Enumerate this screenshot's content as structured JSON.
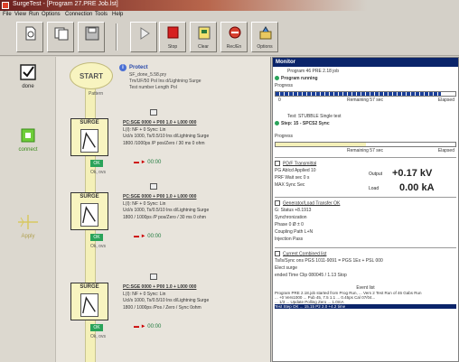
{
  "window": {
    "title": "SurgeTest - [Program 27.PRE Job.lst]"
  },
  "menu": [
    "File",
    "View",
    "Run",
    "Options",
    "Connection",
    "Tools",
    "Help"
  ],
  "toolbar": {
    "buttons": [
      {
        "name": "new-button",
        "label": "",
        "icon": "document-icon"
      },
      {
        "name": "copy-button",
        "label": "",
        "icon": "copy-icon"
      },
      {
        "name": "save-button",
        "label": "",
        "icon": "disk-icon"
      },
      {
        "name": "run-button",
        "label": "",
        "icon": "play-icon"
      },
      {
        "name": "stop-button",
        "label": "Stop",
        "icon": "stop-icon"
      },
      {
        "name": "clear-button",
        "label": "Clear",
        "icon": "clear-icon"
      },
      {
        "name": "record-button",
        "label": "Rec/En",
        "icon": "record-icon"
      },
      {
        "name": "options-button",
        "label": "Options",
        "icon": "tools-icon"
      }
    ]
  },
  "rail": {
    "items": [
      {
        "label": "done",
        "icon": "checkbox-icon"
      },
      {
        "label": "connect",
        "icon": "connect-icon"
      },
      {
        "label": "Apply",
        "icon": "crosshair-icon"
      }
    ]
  },
  "flow": {
    "start": {
      "label": "START",
      "sub": "Pattern",
      "title": "Protect",
      "lines": [
        "SF_done_5.58.pry",
        "Tm/UF/50 Pol Ins d/Lightning Surge",
        "Test number Length Pol"
      ]
    },
    "steps": [
      {
        "label": "SURGE",
        "badge": "OK",
        "check": "Ok, ovs",
        "lines": [
          "PC:SGE 0000 + P00 1.0 + L000 000",
          "L(I): NF + 0  Sync: Lin",
          "Ucl/s 1000, Ts/0.5/10 Ins d/Lightning Surge",
          "1800 /1000ps /P pos/Zero / 30 ms 0 ohm"
        ],
        "arrow": "00:00"
      },
      {
        "label": "SURGE",
        "badge": "OK",
        "check": "Ok, ovs",
        "lines": [
          "PC:SGE 0000 + P00 1.0 + L000 000",
          "L(I): NF + 0  Sync: Lin",
          "Ucl/s 1000, Ts/0.5/10 Ins d/Lightning Surge",
          "1800 / 1000ps /P pos/Zero / 30 ms 0 ohm"
        ],
        "arrow": "00:00"
      },
      {
        "label": "SURGE",
        "badge": "OK",
        "check": "Ok, ovs",
        "lines": [
          "PC:SGE 0000 + P00 1.0 + L000 000",
          "L(I): NF + 0  Sync: Lin",
          "Ucl/s 1000, Ts/0.5/10 Ins d/Lightning Surge",
          "1800 / 1000ps /Pos / Zero / Sync 0ohm"
        ],
        "arrow": "00:00"
      }
    ]
  },
  "panel": {
    "title": "Monitor",
    "group1": {
      "line1": "Program 46 PRE 2.18 job",
      "line2": "Program running",
      "progress_label": "Progress",
      "progress_value": 0.92,
      "left": "0",
      "mid": "Remaining 57 sec",
      "right": "Elapsed"
    },
    "group2": {
      "line1": "Test: STUBBLE Single test",
      "line2": "Step: 15 - SPCS2 Sync",
      "progress_label": "Progress",
      "progress_value": 0.5,
      "mid": "Remaining 57 sec",
      "right": "Elapsed"
    },
    "measure": {
      "title": "PD/F Transmittal",
      "rows": [
        "PG Ablcd Applied  10",
        "PRF Wait sec  0 s",
        "MAX Sync Sec"
      ],
      "u_label": "Output",
      "u_value": "+0.17 kV",
      "i_label": "Load",
      "i_value": "0.00 kA"
    },
    "status": {
      "title": "Generator/Load Transfer  OK",
      "rows": [
        "G: Status   +8.1913",
        "Synchronization",
        "Phase   0 Ø ± 0",
        "Coupling Path   L+N",
        "Injection   Pass"
      ]
    },
    "counters": {
      "title": "Current Combined list",
      "rows": [
        "Ts/ls/Sync ons   PGS 1011-9091 = PGS 1Ex + PSL 000",
        "Elect surge",
        "ended Time   Clip 080045 / 1.13 Stop"
      ]
    },
    "log": {
      "title": "Event list",
      "rows": [
        "Program PRE 2.18.job started from Prog Run, ... Vers 2 Test Run of 46 Gabs Run",
        "... +0 Vers1000 ... Pub 45, 7.5 1.1 ... 0.45ps Cal 07/04...",
        "... 1/3 ... Update Polling Zero ... 1.0mA"
      ],
      "selected": "Test Step OK ... 15.15 P2 2.0 +4.2 time"
    }
  }
}
